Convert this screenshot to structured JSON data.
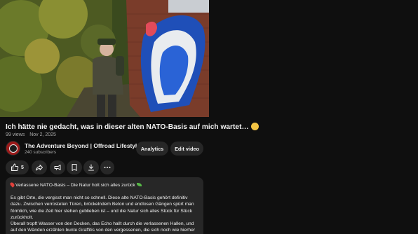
{
  "video": {
    "title": "Ich hätte nie gedacht, was in dieser alten NATO-Basis auf mich wartet…",
    "title_emoji": "smiling-face",
    "views": "99 views",
    "date": "Nov 2, 2025"
  },
  "channel": {
    "name": "The Adventure Beyond | Offroad Lifestyl...",
    "subscribers": "240 subscribers"
  },
  "owner_actions": {
    "analytics_label": "Analytics",
    "edit_label": "Edit video"
  },
  "actions": {
    "like_count": "5",
    "icons": [
      "thumbs-up-icon",
      "share-icon",
      "clip-icon",
      "save-icon",
      "download-icon",
      "more-icon"
    ]
  },
  "description": {
    "heading": "Verlassene NATO-Basis – Die Natur holt sich alles zurück",
    "paragraph1": "Es gibt Orte, die vergisst man nicht so schnell. Diese alte NATO-Basis gehört definitiv dazu. Zwischen verrosteten Türen, bröckelndem Beton und endlosen Gängen spürt man förmlich, wie die Zeit hier stehen geblieben ist – und die Natur sich alles Stück für Stück zurückholt.",
    "paragraph2": "Überall tropft Wasser von den Decken, das Echo hallt durch die verlassenen Hallen, und auf den Wänden erzählen bunte Graffitis von den vergessenen, die sich noch wie hierher"
  },
  "colors": {
    "background": "#0f0f0f",
    "surface": "#272727",
    "text_primary": "#f1f1f1",
    "text_secondary": "#aaaaaa"
  }
}
